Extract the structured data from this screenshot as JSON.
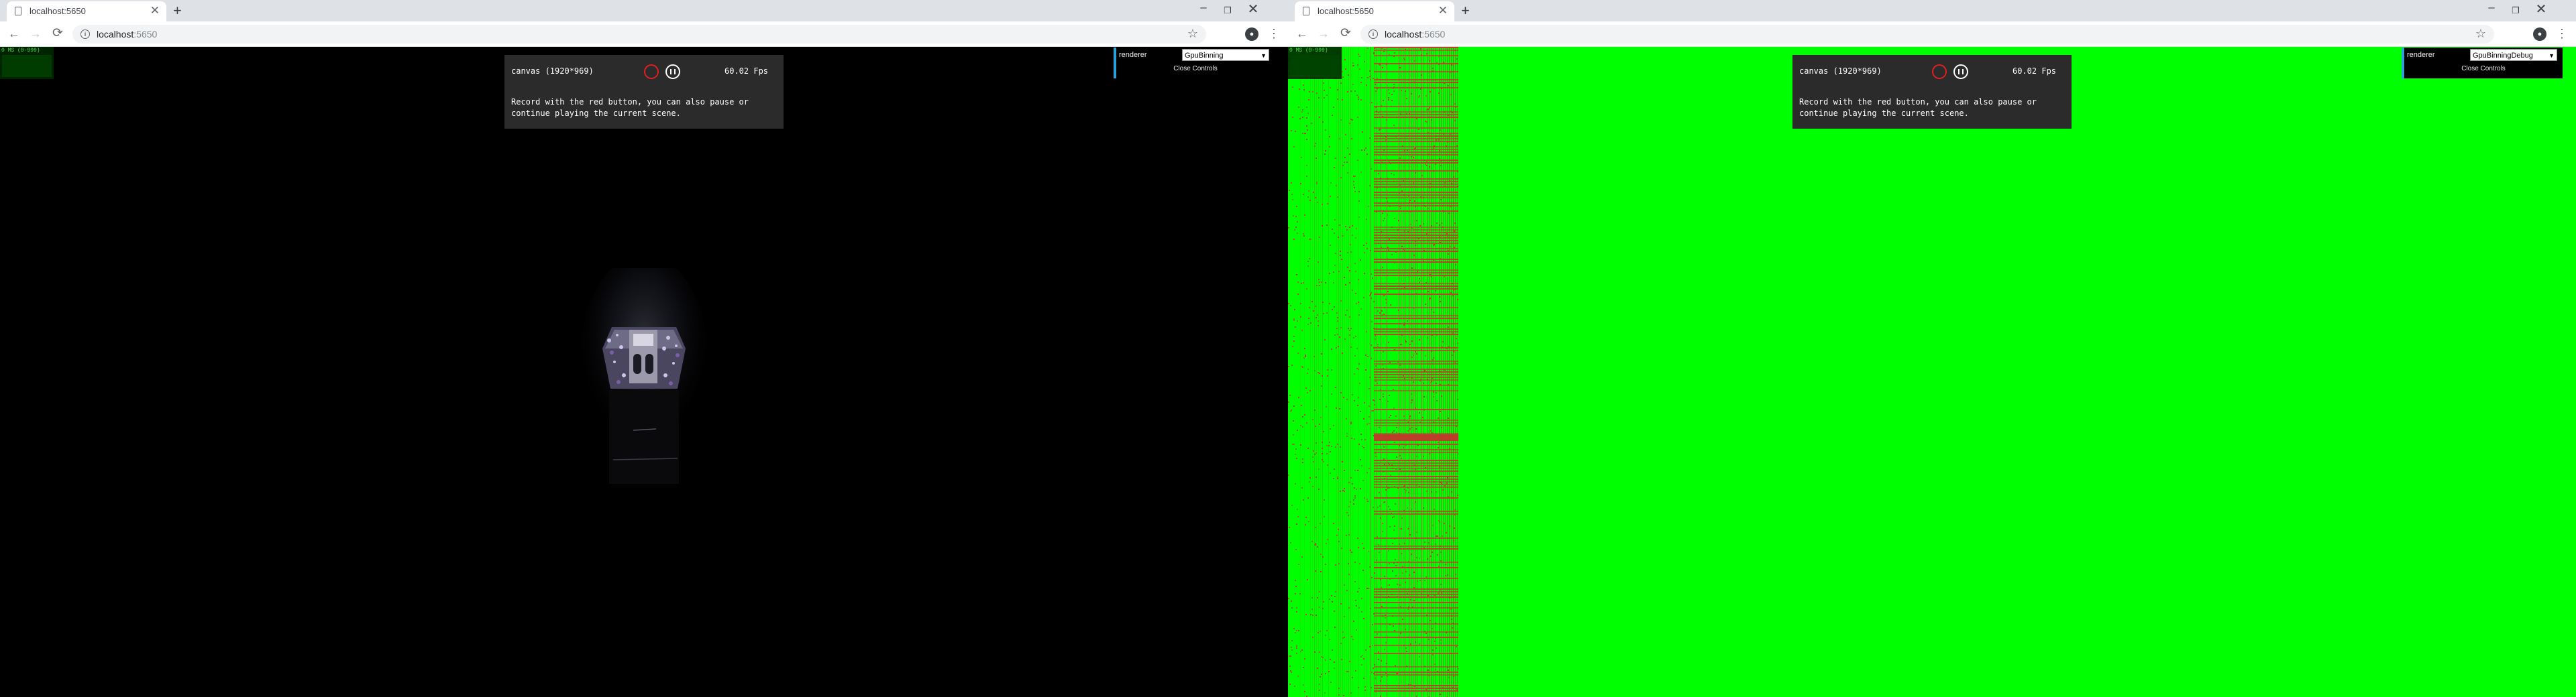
{
  "browser": {
    "tab_title": "localhost:5650",
    "new_tab": "+",
    "url_host": "localhost",
    "url_port": ":5650",
    "window_controls": {
      "minimize": "–",
      "maximize": "❐",
      "close": "✕"
    },
    "nav": {
      "back": "←",
      "forward": "→",
      "reload": "⟳"
    },
    "icons": [
      "page-icon",
      "info-icon",
      "star-icon",
      "avatar",
      "menu-icon"
    ]
  },
  "windows": [
    {
      "stats_text": "0 MS (0-999)",
      "recorder": {
        "canvas_label": "canvas (1920*969)",
        "fps": "60.02 Fps",
        "description": "Record with the red button, you can also pause or continue playing the current scene."
      },
      "gui": {
        "label": "renderer",
        "value": "GpuBinning",
        "close": "Close Controls"
      }
    },
    {
      "stats_text": "0 MS (0-999)",
      "recorder": {
        "canvas_label": "canvas (1920*969)",
        "fps": "60.02 Fps",
        "description": "Record with the red button, you can also pause or continue playing the current scene."
      },
      "gui": {
        "label": "renderer",
        "value": "GpuBinningDebug",
        "close": "Close Controls"
      }
    }
  ],
  "colors": {
    "accent": "#2fa1d6",
    "debug_bg": "#00ff00",
    "bin_hit": "#c0392b",
    "record": "#e02020"
  }
}
